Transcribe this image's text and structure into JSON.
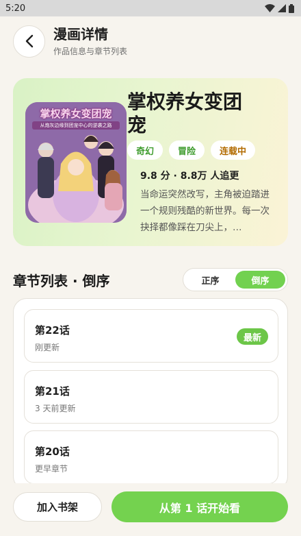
{
  "status": {
    "time": "5:20"
  },
  "header": {
    "title": "漫画详情",
    "subtitle": "作品信息与章节列表"
  },
  "comic": {
    "cover_title": "掌权养女变团宠",
    "cover_subtitle": "从炮灰边缘到团宠中心的逆袭之路",
    "title": "掌权养女变团宠",
    "tags": [
      {
        "label": "奇幻"
      },
      {
        "label": "冒险"
      },
      {
        "label": "连载中"
      }
    ],
    "rating": "9.8 分 · 8.8万 人追更",
    "description": "当命运突然改写，主角被迫踏进一个规则残酷的新世界。每一次抉择都像踩在刀尖上，…"
  },
  "chapter_section": {
    "title": "章节列表 · 倒序",
    "sort_options": [
      "正序",
      "倒序"
    ],
    "active_sort": "倒序"
  },
  "chapters": [
    {
      "title": "第22话",
      "meta": "刚更新",
      "badge": "最新"
    },
    {
      "title": "第21话",
      "meta": "3 天前更新"
    },
    {
      "title": "第20话",
      "meta": "更早章节"
    }
  ],
  "actions": {
    "shelf": "加入书架",
    "read": "从第 1 话开始看"
  },
  "colors": {
    "accent": "#72d150",
    "tag_green": "#3f9c2e",
    "tag_orange": "#b26b00"
  }
}
